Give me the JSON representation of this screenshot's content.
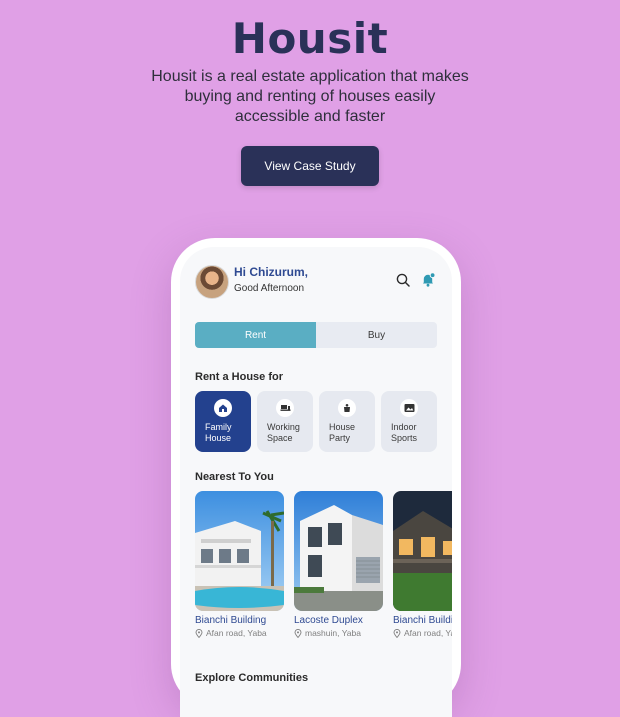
{
  "hero": {
    "title": "Housit",
    "description": "Housit is a real estate application that makes buying and renting of houses easily accessible and faster",
    "cta_label": "View Case Study"
  },
  "app": {
    "greeting": {
      "name": "Hi Chizurum,",
      "subtitle": "Good Afternoon"
    },
    "toggle": {
      "rent": "Rent",
      "buy": "Buy",
      "selected": "Rent"
    },
    "rent_section": {
      "title": "Rent a House for",
      "categories": [
        {
          "label": "Family House",
          "icon": "house-icon",
          "active": true
        },
        {
          "label": "Working Space",
          "icon": "desk-icon",
          "active": false
        },
        {
          "label": "House Party",
          "icon": "party-icon",
          "active": false
        },
        {
          "label": "Indoor Sports",
          "icon": "picture-icon",
          "active": false
        }
      ]
    },
    "nearest_section": {
      "title": "Nearest To You",
      "properties": [
        {
          "name": "Bianchi Building",
          "location": "Afan road, Yaba"
        },
        {
          "name": "Lacoste Duplex",
          "location": "mashuin, Yaba"
        },
        {
          "name": "Bianchi Building",
          "location": "Afan road, Yaba"
        }
      ]
    },
    "explore_title": "Explore Communities"
  },
  "colors": {
    "background": "#e0a0e6",
    "primary": "#2a3158",
    "accent_blue": "#23418e",
    "teal": "#5aaec3"
  }
}
